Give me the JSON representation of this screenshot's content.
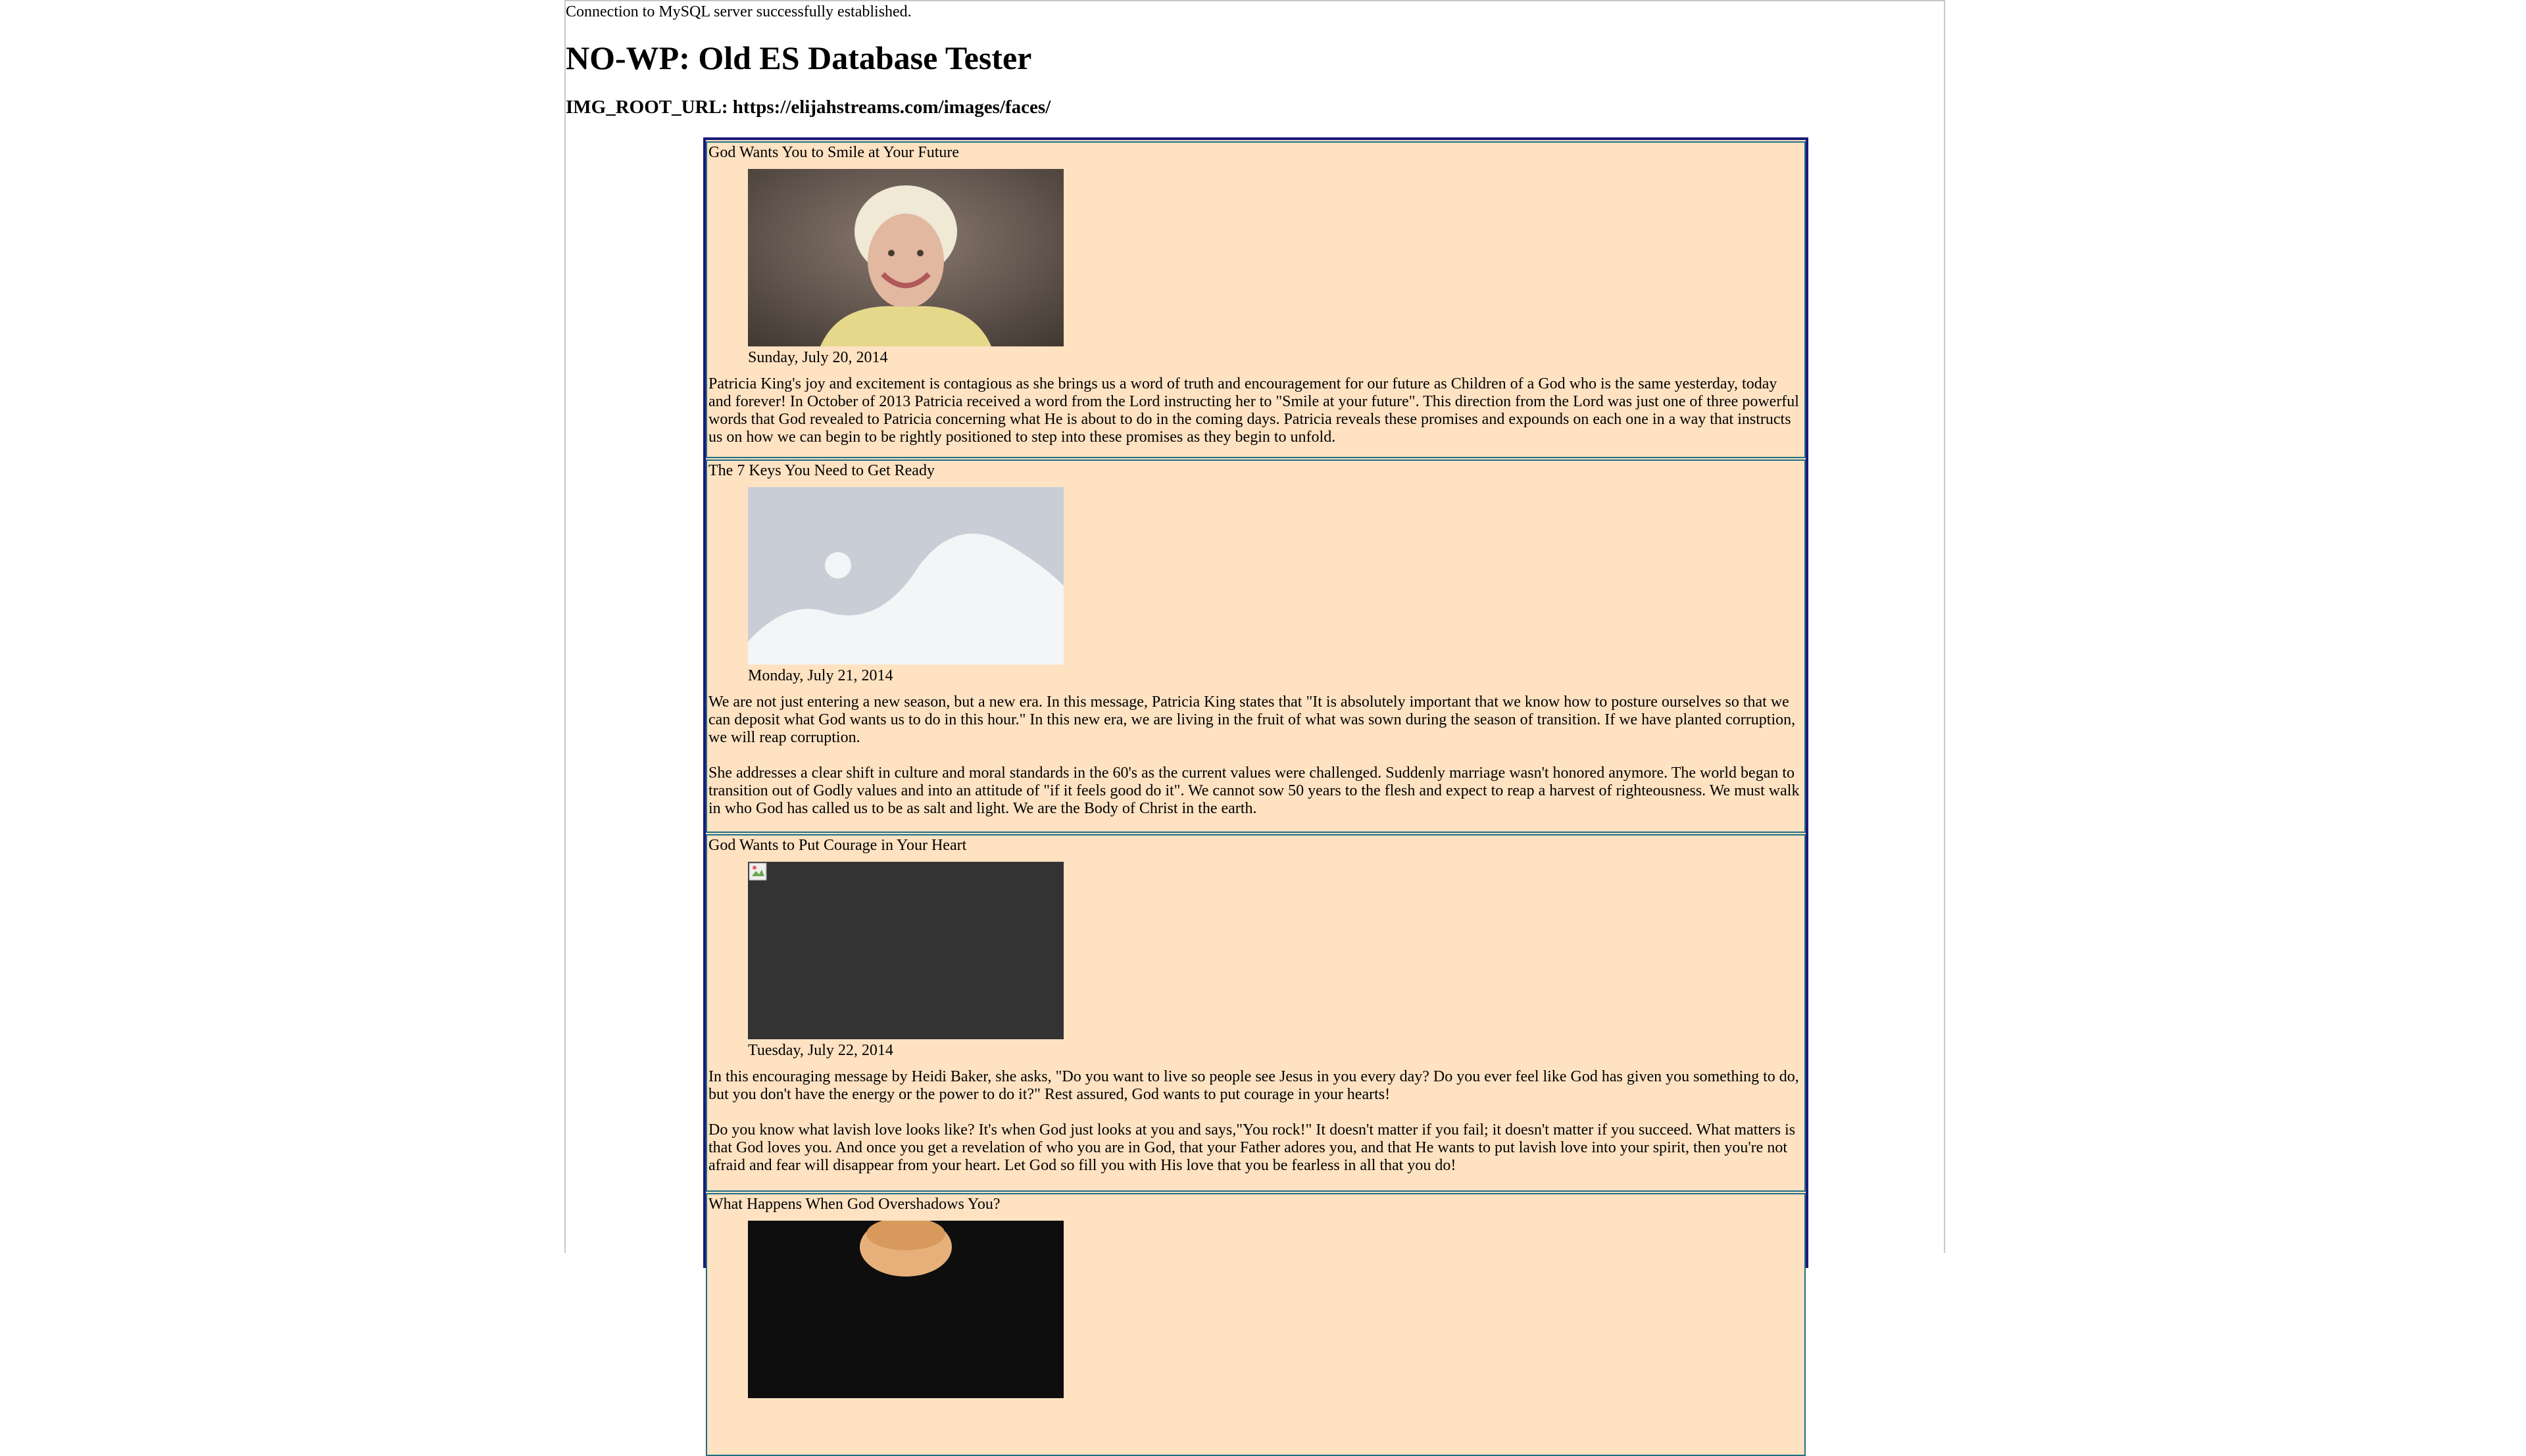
{
  "status_text": "Connection to MySQL server successfully established.",
  "page_title": "NO-WP: Old ES Database Tester",
  "img_root": "IMG_ROOT_URL: https://elijahstreams.com/images/faces/",
  "entries": [
    {
      "title": "God Wants You to Smile at Your Future",
      "image": "portrait-photo",
      "date": "Sunday, July 20, 2014",
      "paragraphs": [
        "Patricia King's joy and excitement is contagious as she brings us a word of truth and encouragement for our future as Children of a God who is the same yesterday, today and forever! In October of 2013 Patricia received a word from the Lord instructing her to \"Smile at your future\". This direction from the Lord was just one of three powerful words that God revealed to Patricia concerning what He is about to do in the coming days. Patricia reveals these promises and expounds on each one in a way that instructs us on how we can begin to be rightly positioned to step into these promises as they begin to unfold."
      ]
    },
    {
      "title": "The 7 Keys You Need to Get Ready",
      "image": "image-placeholder-icon",
      "date": "Monday, July 21, 2014",
      "paragraphs": [
        "We are not just entering a new season, but a new era. In this message, Patricia King states that \"It is absolutely important that we know how to posture ourselves so that we can deposit what God wants us to do in this hour.\" In this new era, we are living in the fruit of what was sown during the season of transition. If we have planted corruption, we will reap corruption.",
        "She addresses a clear shift in culture and moral standards in the 60's as the current values were challenged. Suddenly marriage wasn't honored anymore. The world began to transition out of Godly values and into an attitude of \"if it feels good do it\". We cannot sow 50 years to the flesh and expect to reap a harvest of righteousness. We must walk in who God has called us to be as salt and light. We are the Body of Christ in the earth."
      ]
    },
    {
      "title": "God Wants to Put Courage in Your Heart",
      "image": "broken-image-icon",
      "date": "Tuesday, July 22, 2014",
      "paragraphs": [
        "In this encouraging message by Heidi Baker, she asks, \"Do you want to live so people see Jesus in you every day? Do you ever feel like God has given you something to do, but you don't have the energy or the power to do it?\" Rest assured, God wants to put courage in your hearts!",
        "Do you know what lavish love looks like? It's when God just looks at you and says,\"You rock!\" It doesn't matter if you fail; it doesn't matter if you succeed. What matters is that God loves you. And once you get a revelation of who you are in God, that your Father adores you, and that He wants to put lavish love into your spirit, then you're not afraid and fear will disappear from your heart. Let God so fill you with His love that you be fearless in all that you do!"
      ]
    },
    {
      "title": "What Happens When God Overshadows You?",
      "image": "portrait-photo-dark",
      "date": "",
      "paragraphs": []
    }
  ]
}
